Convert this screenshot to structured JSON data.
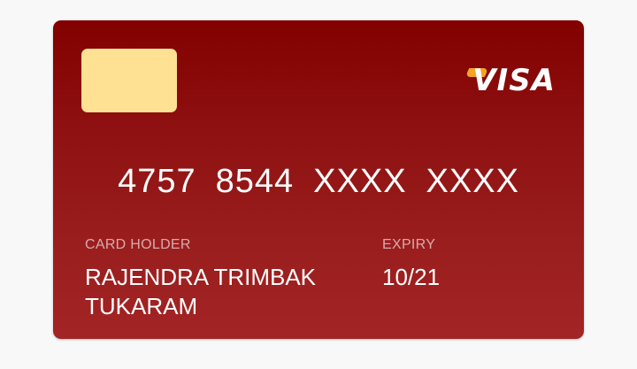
{
  "card": {
    "brand": "VISA",
    "number_groups": [
      "4757",
      "8544",
      "XXXX",
      "XXXX"
    ],
    "holder_label": "CARD HOLDER",
    "holder_name": "RAJENDRA TRIMBAK TUKARAM",
    "expiry_label": "EXPIRY",
    "expiry_value": "10/21"
  },
  "colors": {
    "card_top": "#820000",
    "card_bottom": "#a32424",
    "chip": "#ffe194",
    "brand_accent": "#f3a425",
    "background": "#f8f8f9"
  }
}
